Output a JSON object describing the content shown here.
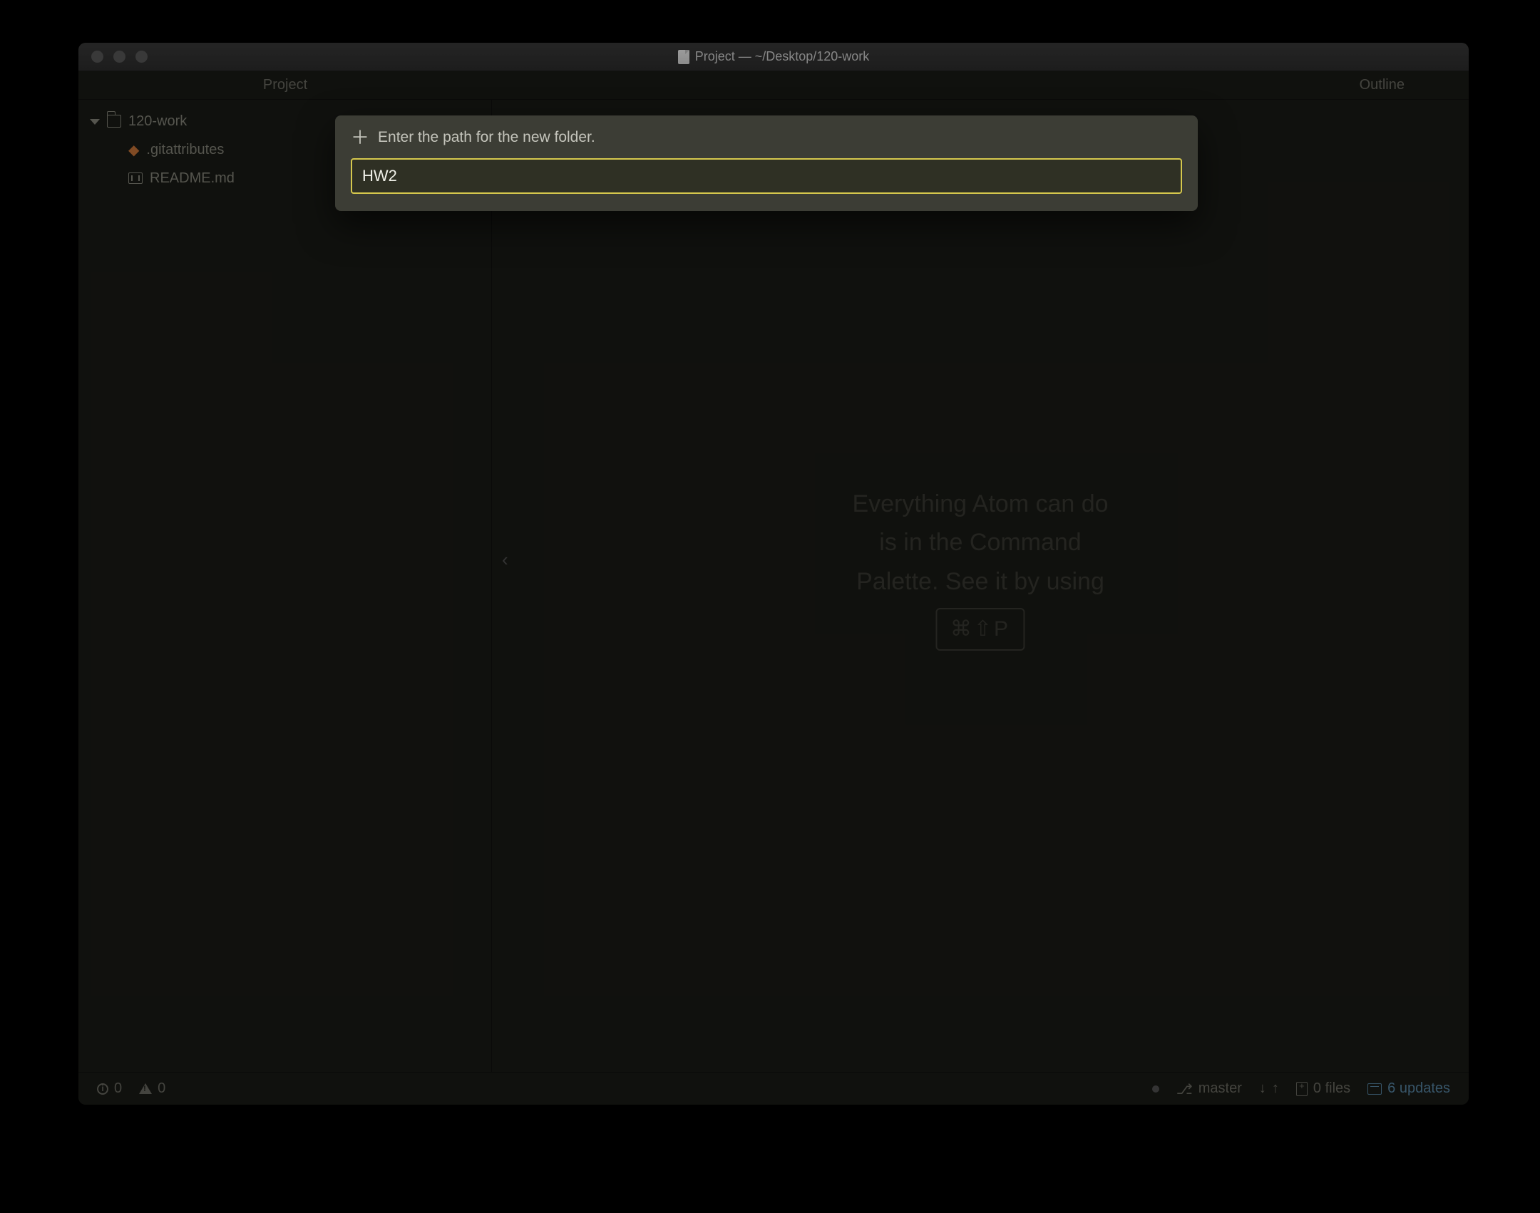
{
  "titlebar": {
    "title": "Project — ~/Desktop/120-work"
  },
  "panels": {
    "left": "Project",
    "right": "Outline"
  },
  "tree": {
    "root": "120-work",
    "items": [
      {
        "label": ".gitattributes",
        "icon": "git"
      },
      {
        "label": "README.md",
        "icon": "md"
      }
    ]
  },
  "welcome": {
    "line1": "Everything Atom can do",
    "line2": "is in the Command",
    "line3": "Palette. See it by using",
    "kbd": "⌘⇧P"
  },
  "modal": {
    "label": "Enter the path for the new folder.",
    "value": "HW2"
  },
  "statusbar": {
    "info_count": "0",
    "warn_count": "0",
    "branch": "master",
    "files": "0 files",
    "updates": "6 updates"
  }
}
